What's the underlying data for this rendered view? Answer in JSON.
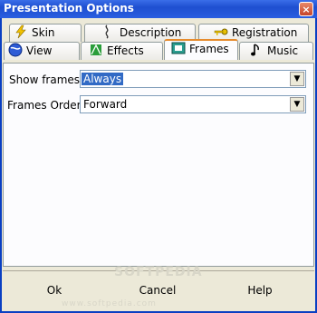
{
  "window": {
    "title": "Presentation Options",
    "close_label": "×"
  },
  "tabs_row1": [
    {
      "label": "Skin"
    },
    {
      "label": "Description"
    },
    {
      "label": "Registration"
    }
  ],
  "tabs_row2": [
    {
      "label": "View"
    },
    {
      "label": "Effects"
    },
    {
      "label": "Frames",
      "active": true
    },
    {
      "label": "Music"
    }
  ],
  "frames": {
    "show_frames_label": "Show frames",
    "show_frames_value": "Always",
    "frames_order_label": "Frames Order",
    "frames_order_value": "Forward"
  },
  "buttons": {
    "ok": "Ok",
    "cancel": "Cancel",
    "help": "Help"
  },
  "watermarks": {
    "brand": "SOFTPEDIA",
    "url": "www.softpedia.com"
  },
  "colors": {
    "accent": "#316ac5",
    "title_bar": "#1e4fd0",
    "active_tab": "#e68b2c"
  }
}
